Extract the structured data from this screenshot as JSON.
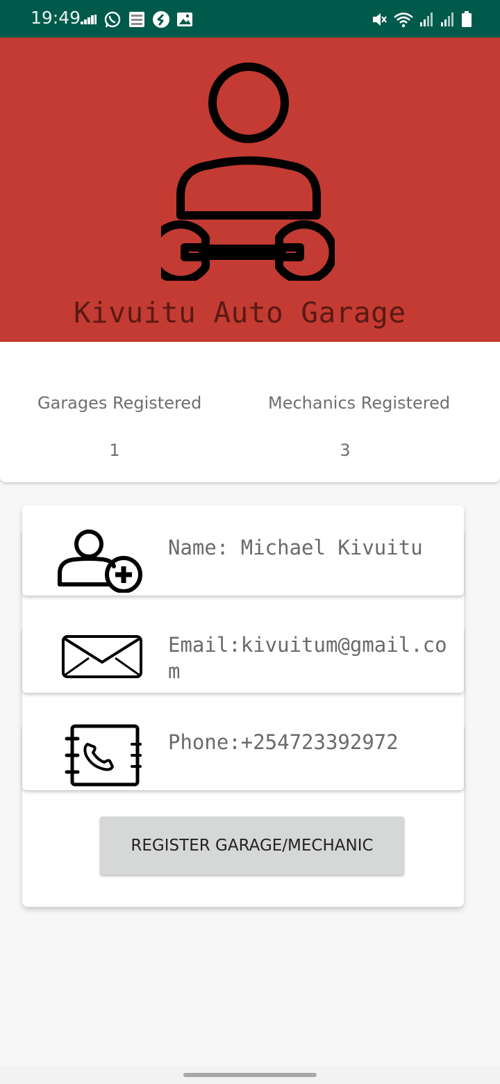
{
  "status_bar": {
    "time": "19:49",
    "left_icons": [
      "data-signal-icon",
      "whatsapp-icon",
      "bible-app-icon",
      "shazam-icon",
      "image-icon"
    ],
    "right_icons": [
      "mute-icon",
      "wifi-icon",
      "signal-icon",
      "signal-icon-2",
      "battery-icon"
    ]
  },
  "header": {
    "title": "Kivuitu Auto Garage",
    "logo_icon": "mechanic-icon",
    "background_color": "#c33b32"
  },
  "stats": {
    "garages_label": "Garages Registered",
    "garages_count": "1",
    "mechanics_label": "Mechanics Registered",
    "mechanics_count": "3"
  },
  "profile": {
    "name": "Name: Michael Kivuitu",
    "email": "Email:kivuitum@gmail.com",
    "phone": "Phone:+254723392972",
    "name_icon": "add-user-icon",
    "email_icon": "envelope-icon",
    "phone_icon": "phonebook-icon"
  },
  "actions": {
    "register_label": "REGISTER GARAGE/MECHANIC"
  }
}
